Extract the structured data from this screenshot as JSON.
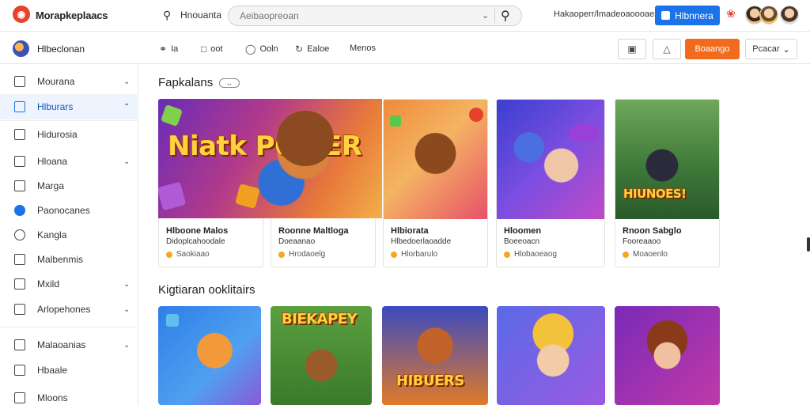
{
  "header": {
    "brand": "Morapkeplaacs",
    "search_label": "Hnouanta",
    "search_placeholder": "Aeibaopreoan",
    "top_link": "Hakaoperr/lmadeoaoooaes",
    "signin_label": "Hlbnnera"
  },
  "subheader": {
    "user_name": "Hlbeclonan",
    "tabs": [
      {
        "label": "Ia",
        "icon": "tag-icon"
      },
      {
        "label": "oot",
        "icon": "box-icon"
      },
      {
        "label": "Ooln",
        "icon": "chat-icon"
      },
      {
        "label": "Ealoe",
        "icon": "refresh-icon"
      },
      {
        "label": "Menos",
        "icon": ""
      }
    ],
    "orange_button": "Boaango",
    "dropdown_label": "Pcacar"
  },
  "sidebar": {
    "items": [
      {
        "label": "Mourana",
        "chevron": "down"
      },
      {
        "label": "Hlburars",
        "chevron": "up",
        "active": true
      },
      {
        "label": "Hidurosia",
        "chevron": ""
      },
      {
        "label": "Hloana",
        "chevron": "down"
      },
      {
        "label": "Marga",
        "chevron": ""
      },
      {
        "label": "Paonocanes",
        "chevron": ""
      },
      {
        "label": "Kangla",
        "chevron": ""
      },
      {
        "label": "Malbenmis",
        "chevron": ""
      },
      {
        "label": "Mxild",
        "chevron": "down"
      },
      {
        "label": "Arlopehones",
        "chevron": "down"
      },
      {
        "label": "Malaoanias",
        "chevron": "down"
      },
      {
        "label": "Hbaale",
        "chevron": ""
      },
      {
        "label": "Mloons",
        "chevron": ""
      }
    ]
  },
  "main": {
    "section1_title": "Fapkalans",
    "section1_pill": "↔",
    "section2_title": "Kigtiaran ooklitairs",
    "featured_art_text": "Niatk POMER",
    "cards": [
      {
        "title": "Hlboone Malos",
        "subtitle": "Didoplcahoodale",
        "meta": "Saokiaao",
        "art_text": ""
      },
      {
        "title": "Roonne Maltloga",
        "subtitle": "Doeaanao",
        "meta": "Hrodaoelg",
        "art_text": ""
      },
      {
        "title": "Hlbiorata",
        "subtitle": "Hlbedoerlaoadde",
        "meta": "Hlorbarulo",
        "art_text": ""
      },
      {
        "title": "Hloomen",
        "subtitle": "Boeeoacn",
        "meta": "Hlobaoeaog",
        "art_text": ""
      },
      {
        "title": "Rnoon Sabglo",
        "subtitle": "Fooreaaoo",
        "meta": "Moaoenlo",
        "art_text": "HIUNOES!"
      }
    ],
    "row2_art_texts": [
      "",
      "BIEKAPEY",
      "HIBUERS",
      "",
      ""
    ]
  },
  "colors": {
    "accent_blue": "#1a73e8",
    "accent_orange": "#f26b1d",
    "brand_red": "#e8412c"
  }
}
